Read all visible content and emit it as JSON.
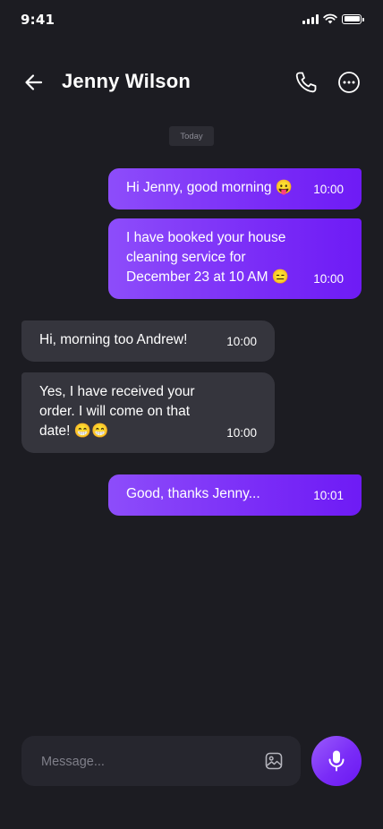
{
  "status_bar": {
    "time": "9:41"
  },
  "header": {
    "contact_name": "Jenny Wilson",
    "icons": [
      "back-arrow-icon",
      "phone-icon",
      "more-options-icon"
    ]
  },
  "date_divider": "Today",
  "messages": [
    {
      "direction": "outgoing",
      "text": "Hi Jenny, good morning 😛",
      "time": "10:00"
    },
    {
      "direction": "outgoing",
      "text": "I have booked your house cleaning service for December 23 at 10 AM 😑",
      "time": "10:00"
    },
    {
      "direction": "incoming",
      "text": "Hi, morning too Andrew!",
      "time": "10:00"
    },
    {
      "direction": "incoming",
      "text": "Yes, I have received your order. I will come on that date! 😁😁",
      "time": "10:00"
    },
    {
      "direction": "outgoing",
      "text": "Good, thanks Jenny...",
      "time": "10:01"
    }
  ],
  "composer": {
    "placeholder": "Message...",
    "value": "",
    "icons": [
      "image-attach-icon",
      "microphone-icon"
    ]
  },
  "colors": {
    "background": "#1c1c22",
    "outgoing_bubble": "#7a2cf7",
    "incoming_bubble": "#35353d",
    "accent": "#7a2cf7"
  }
}
